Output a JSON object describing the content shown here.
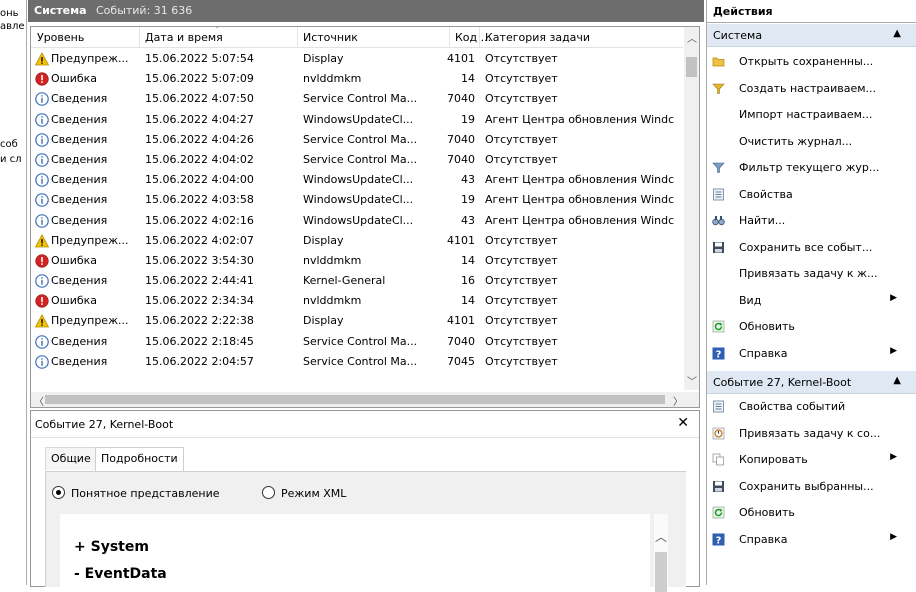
{
  "left_fragments": [
    "онь",
    "авле",
    "соб",
    "и сл"
  ],
  "header": {
    "title": "Система",
    "count": "Событий: 31 636"
  },
  "columns": [
    "Уровень",
    "Дата и время",
    "Источник",
    "Код ...",
    "Категория задачи"
  ],
  "events": [
    {
      "level": "Предупреж...",
      "icon": "warning-icon",
      "date": "15.06.2022 5:07:54",
      "source": "Display",
      "code": "4101",
      "category": "Отсутствует"
    },
    {
      "level": "Ошибка",
      "icon": "error-icon",
      "date": "15.06.2022 5:07:09",
      "source": "nvlddmkm",
      "code": "14",
      "category": "Отсутствует"
    },
    {
      "level": "Сведения",
      "icon": "info-icon",
      "date": "15.06.2022 4:07:50",
      "source": "Service Control Ma...",
      "code": "7040",
      "category": "Отсутствует"
    },
    {
      "level": "Сведения",
      "icon": "info-icon",
      "date": "15.06.2022 4:04:27",
      "source": "WindowsUpdateCl...",
      "code": "19",
      "category": "Агент Центра обновления Windc"
    },
    {
      "level": "Сведения",
      "icon": "info-icon",
      "date": "15.06.2022 4:04:26",
      "source": "Service Control Ma...",
      "code": "7040",
      "category": "Отсутствует"
    },
    {
      "level": "Сведения",
      "icon": "info-icon",
      "date": "15.06.2022 4:04:02",
      "source": "Service Control Ma...",
      "code": "7040",
      "category": "Отсутствует"
    },
    {
      "level": "Сведения",
      "icon": "info-icon",
      "date": "15.06.2022 4:04:00",
      "source": "WindowsUpdateCl...",
      "code": "43",
      "category": "Агент Центра обновления Windc"
    },
    {
      "level": "Сведения",
      "icon": "info-icon",
      "date": "15.06.2022 4:03:58",
      "source": "WindowsUpdateCl...",
      "code": "19",
      "category": "Агент Центра обновления Windc"
    },
    {
      "level": "Сведения",
      "icon": "info-icon",
      "date": "15.06.2022 4:02:16",
      "source": "WindowsUpdateCl...",
      "code": "43",
      "category": "Агент Центра обновления Windc"
    },
    {
      "level": "Предупреж...",
      "icon": "warning-icon",
      "date": "15.06.2022 4:02:07",
      "source": "Display",
      "code": "4101",
      "category": "Отсутствует"
    },
    {
      "level": "Ошибка",
      "icon": "error-icon",
      "date": "15.06.2022 3:54:30",
      "source": "nvlddmkm",
      "code": "14",
      "category": "Отсутствует"
    },
    {
      "level": "Сведения",
      "icon": "info-icon",
      "date": "15.06.2022 2:44:41",
      "source": "Kernel-General",
      "code": "16",
      "category": "Отсутствует"
    },
    {
      "level": "Ошибка",
      "icon": "error-icon",
      "date": "15.06.2022 2:34:34",
      "source": "nvlddmkm",
      "code": "14",
      "category": "Отсутствует"
    },
    {
      "level": "Предупреж...",
      "icon": "warning-icon",
      "date": "15.06.2022 2:22:38",
      "source": "Display",
      "code": "4101",
      "category": "Отсутствует"
    },
    {
      "level": "Сведения",
      "icon": "info-icon",
      "date": "15.06.2022 2:18:45",
      "source": "Service Control Ma...",
      "code": "7040",
      "category": "Отсутствует"
    },
    {
      "level": "Сведения",
      "icon": "info-icon",
      "date": "15.06.2022 2:04:57",
      "source": "Service Control Ma...",
      "code": "7045",
      "category": "Отсутствует"
    }
  ],
  "detail": {
    "title": "Событие 27, Kernel-Boot",
    "tabs": [
      "Общие",
      "Подробности"
    ],
    "radio_friendly": "Понятное представление",
    "radio_xml": "Режим XML",
    "xml_lines": [
      "+ System",
      "- EventData"
    ]
  },
  "actions": {
    "title": "Действия",
    "section1": "Система",
    "items1": [
      {
        "label": "Открыть сохраненны...",
        "icon": "folder-icon"
      },
      {
        "label": "Создать настраиваем...",
        "icon": "filter-create-icon"
      },
      {
        "label": "Импорт настраиваем...",
        "icon": ""
      },
      {
        "label": "Очистить журнал...",
        "icon": ""
      },
      {
        "label": "Фильтр текущего жур...",
        "icon": "filter-icon"
      },
      {
        "label": "Свойства",
        "icon": "properties-icon"
      },
      {
        "label": "Найти...",
        "icon": "find-icon"
      },
      {
        "label": "Сохранить все событ...",
        "icon": "save-icon"
      },
      {
        "label": "Привязать задачу к ж...",
        "icon": ""
      },
      {
        "label": "Вид",
        "icon": "",
        "submenu": true
      },
      {
        "label": "Обновить",
        "icon": "refresh-icon"
      },
      {
        "label": "Справка",
        "icon": "help-icon",
        "submenu": true
      }
    ],
    "section2": "Событие 27, Kernel-Boot",
    "items2": [
      {
        "label": "Свойства событий",
        "icon": "properties-icon"
      },
      {
        "label": "Привязать задачу к со...",
        "icon": "task-icon"
      },
      {
        "label": "Копировать",
        "icon": "copy-icon",
        "submenu": true
      },
      {
        "label": "Сохранить выбранны...",
        "icon": "save-icon"
      },
      {
        "label": "Обновить",
        "icon": "refresh-icon"
      },
      {
        "label": "Справка",
        "icon": "help-icon",
        "submenu": true
      }
    ]
  }
}
